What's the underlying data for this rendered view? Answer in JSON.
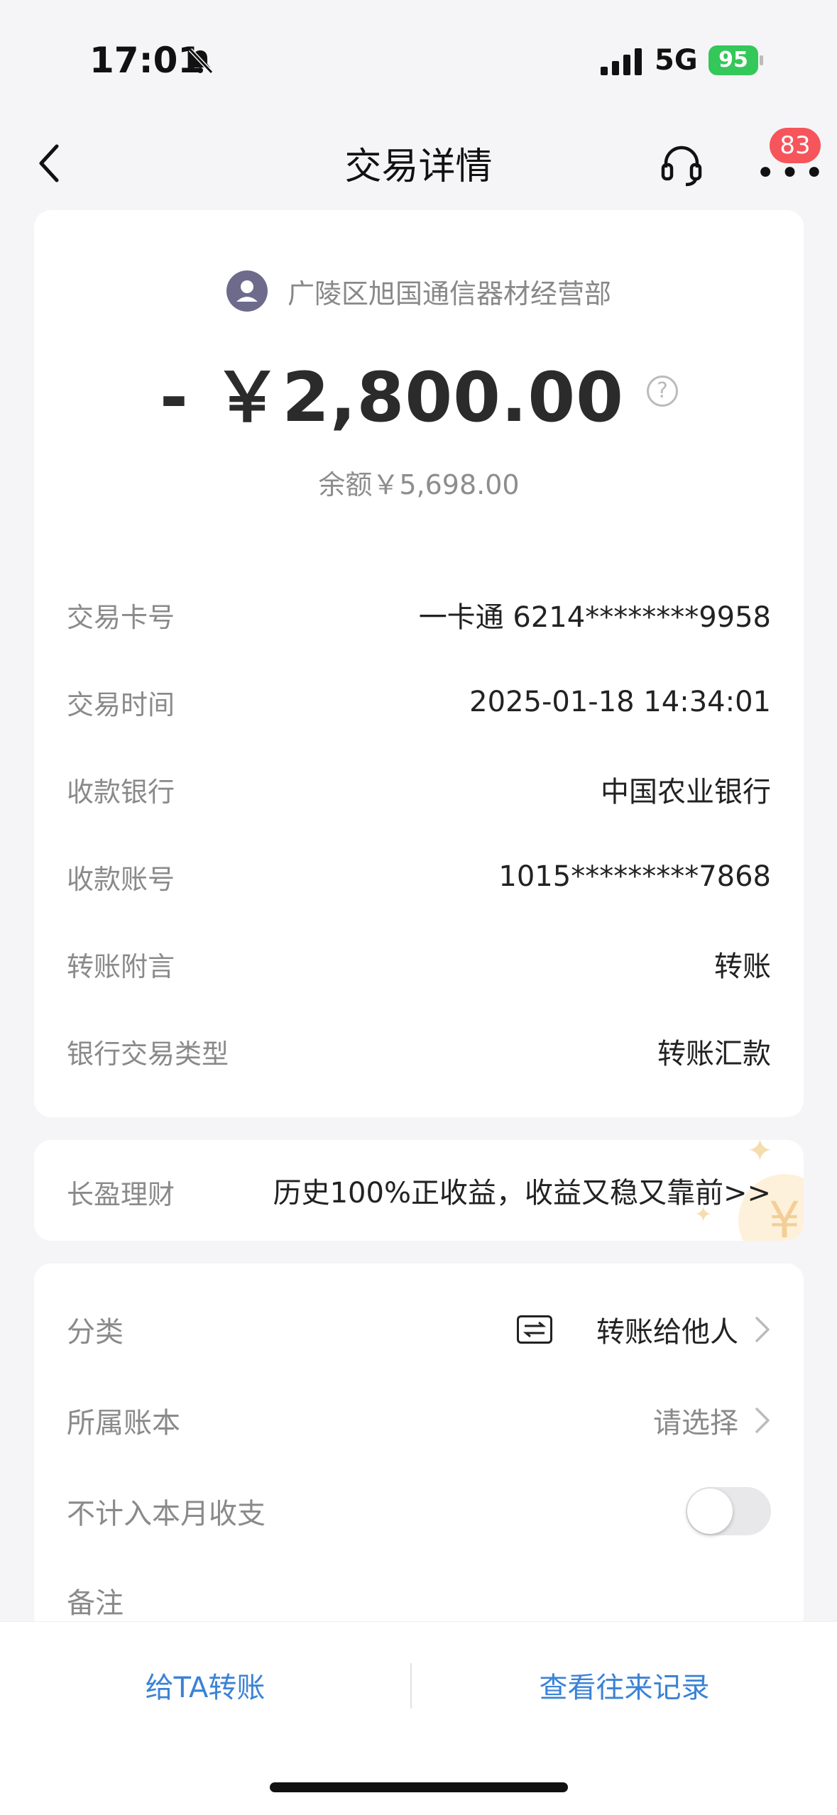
{
  "status": {
    "time": "17:01",
    "network": "5G",
    "battery": "95"
  },
  "nav": {
    "title": "交易详情",
    "badge": "83"
  },
  "transaction": {
    "payee": "广陵区旭国通信器材经营部",
    "amount": "- ￥2,800.00",
    "balance": "余额￥5,698.00",
    "details": [
      {
        "label": "交易卡号",
        "value": "一卡通 6214********9958"
      },
      {
        "label": "交易时间",
        "value": "2025-01-18 14:34:01"
      },
      {
        "label": "收款银行",
        "value": "中国农业银行"
      },
      {
        "label": "收款账号",
        "value": "1015*********7868"
      },
      {
        "label": "转账附言",
        "value": "转账"
      },
      {
        "label": "银行交易类型",
        "value": "转账汇款"
      }
    ]
  },
  "promo": {
    "label": "长盈理财",
    "text": "历史100%正收益，收益又稳又靠前>>"
  },
  "settings": {
    "category_label": "分类",
    "category_value": "转账给他人",
    "ledger_label": "所属账本",
    "ledger_value": "请选择",
    "exclude_label": "不计入本月收支",
    "exclude_on": false,
    "note_label": "备注"
  },
  "bottom": {
    "left": "给TA转账",
    "right": "查看往来记录"
  }
}
